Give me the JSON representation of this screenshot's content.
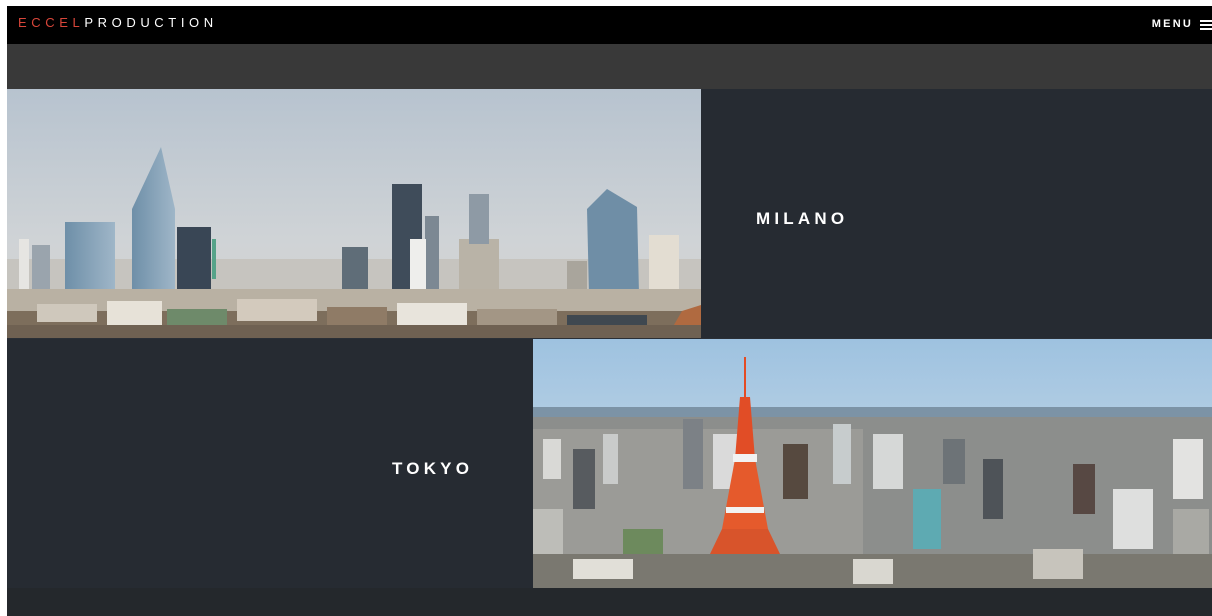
{
  "header": {
    "brand_accent": "ECCEL",
    "brand_main": "PRODUCTION",
    "menu_label": "MENU",
    "menu_icon": "hamburger-icon"
  },
  "cities": [
    {
      "name": "MILANO",
      "image": "milano-skyline-photo"
    },
    {
      "name": "TOKYO",
      "image": "tokyo-skyline-photo"
    }
  ],
  "colors": {
    "brand_accent": "#d9463a",
    "header_bg": "#000000",
    "panel_bg": "#262b32",
    "band_bg": "#393939"
  }
}
